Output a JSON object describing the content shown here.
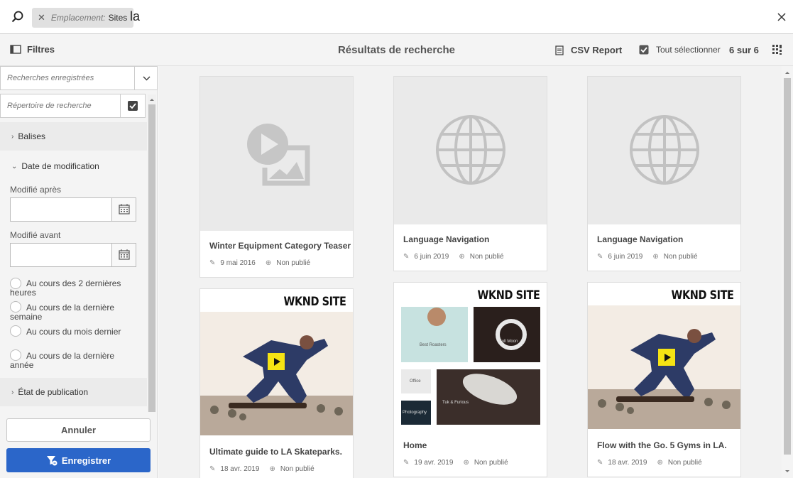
{
  "search": {
    "tag_label": "Emplacement:",
    "tag_value": "Sites",
    "query": "la"
  },
  "toolbar": {
    "filters_label": "Filtres",
    "title": "Résultats de recherche",
    "csv_label": "CSV Report",
    "select_all_label": "Tout sélectionner",
    "count": "6 sur 6"
  },
  "sidebar": {
    "saved_searches_placeholder": "Recherches enregistrées",
    "repo_placeholder": "Répertoire de recherche",
    "sections": {
      "tags": "Balises",
      "modified": "Date de modification",
      "publication": "État de publication"
    },
    "modified_after": "Modifié après",
    "modified_before": "Modifié avant",
    "radios": [
      "Au cours des 2 dernières heures",
      "Au cours de la dernière semaine",
      "Au cours du mois dernier",
      "Au cours de la dernière année"
    ],
    "cancel_label": "Annuler",
    "save_label": "Enregistrer"
  },
  "cards": [
    {
      "title": "Winter Equipment Category Teaser",
      "date": "9 mai 2016",
      "status": "Non publié",
      "thumb": "video-image-icon"
    },
    {
      "title": "Language Navigation",
      "date": "6 juin 2019",
      "status": "Non publié",
      "thumb": "globe-icon"
    },
    {
      "title": "Language Navigation",
      "date": "6 juin 2019",
      "status": "Non publié",
      "thumb": "globe-icon"
    },
    {
      "title": "Ultimate guide to LA Skateparks.",
      "date": "18 avr. 2019",
      "status": "Non publié",
      "thumb": "wknd-skater",
      "brand": "WKND SITE"
    },
    {
      "title": "Home",
      "date": "19 avr. 2019",
      "status": "Non publié",
      "thumb": "wknd-home",
      "brand": "WKND SITE",
      "tiles": [
        "Best Roasters",
        "Full Moon",
        "Office",
        "Tuk & Furious",
        "Photography"
      ]
    },
    {
      "title": "Flow with the Go. 5 Gyms in LA.",
      "date": "18 avr. 2019",
      "status": "Non publié",
      "thumb": "wknd-skater",
      "brand": "WKND SITE"
    }
  ],
  "colors": {
    "accent": "#2b66c9",
    "video_yellow": "#f5e313"
  }
}
